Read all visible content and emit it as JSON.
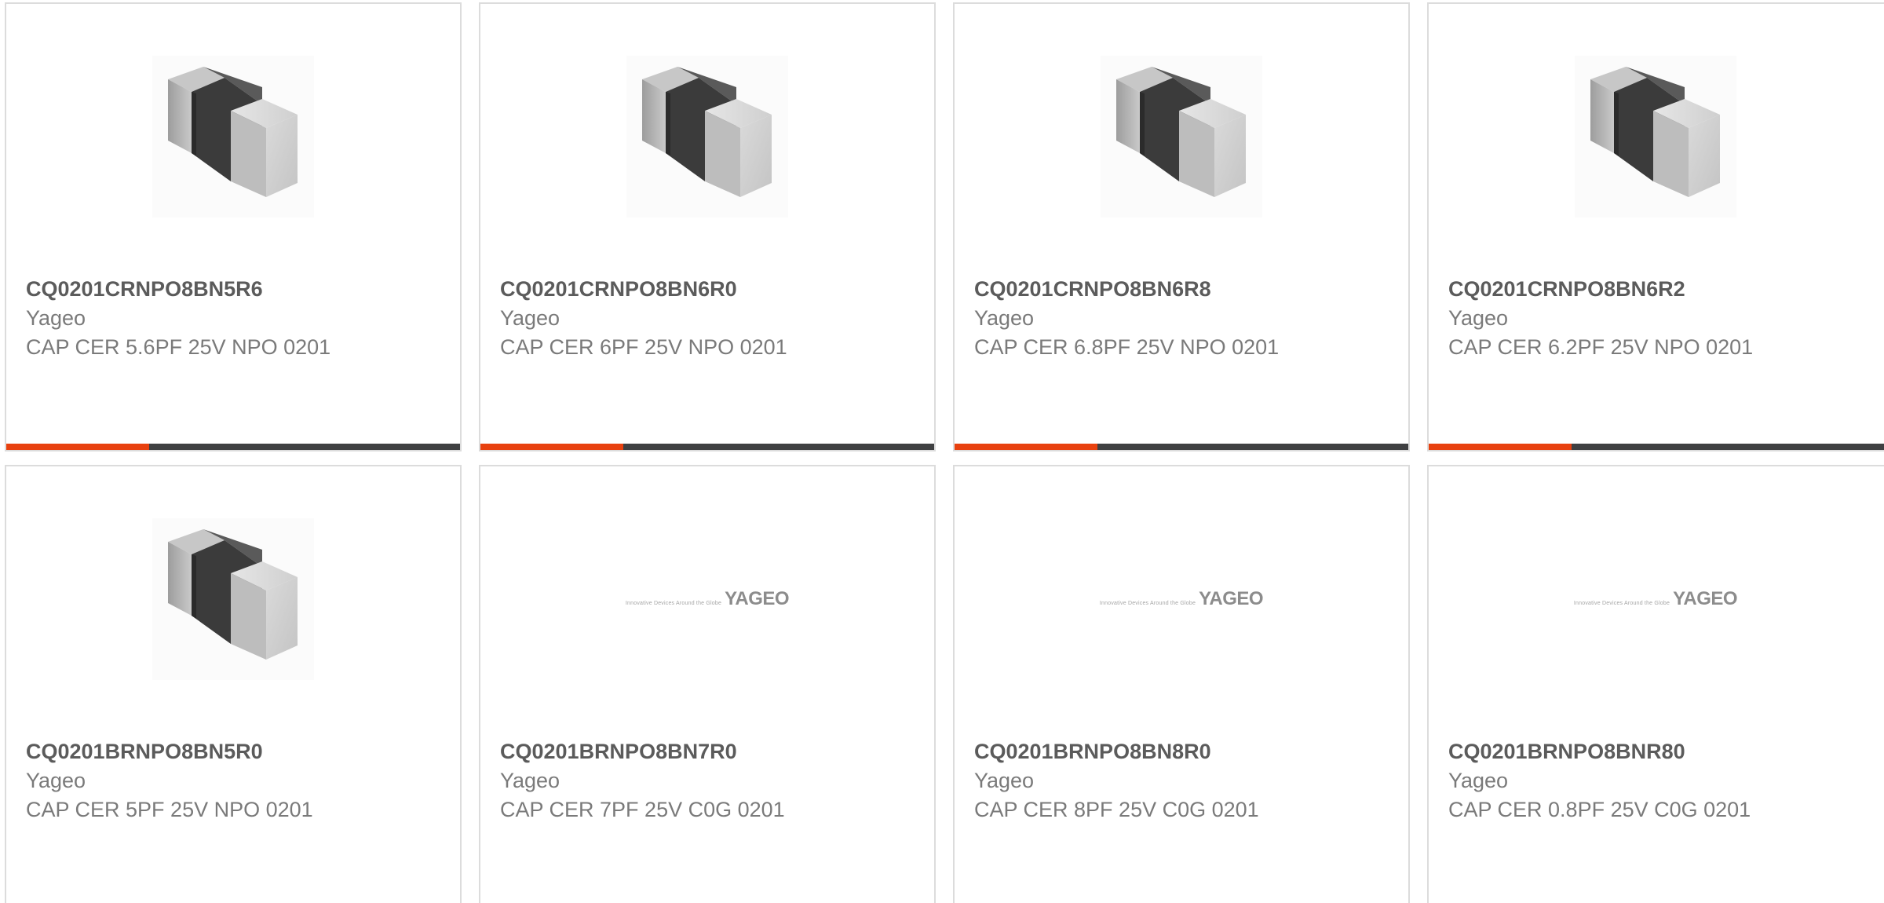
{
  "colors": {
    "accent": "#e8410f",
    "bar": "#3f4042",
    "border": "#dcdcdc"
  },
  "cards": [
    {
      "image": "capacitor-chip-image",
      "part_number": "CQ0201CRNPO8BN5R6",
      "manufacturer": "Yageo",
      "description": "CAP CER 5.6PF 25V NPO 0201",
      "has_bar": true
    },
    {
      "image": "capacitor-chip-image",
      "part_number": "CQ0201CRNPO8BN6R0",
      "manufacturer": "Yageo",
      "description": "CAP CER 6PF 25V NPO 0201",
      "has_bar": true
    },
    {
      "image": "capacitor-chip-image",
      "part_number": "CQ0201CRNPO8BN6R8",
      "manufacturer": "Yageo",
      "description": "CAP CER 6.8PF 25V NPO 0201",
      "has_bar": true
    },
    {
      "image": "capacitor-chip-image",
      "part_number": "CQ0201CRNPO8BN6R2",
      "manufacturer": "Yageo",
      "description": "CAP CER 6.2PF 25V NPO 0201",
      "has_bar": true
    },
    {
      "image": "capacitor-chip-image",
      "part_number": "CQ0201BRNPO8BN5R0",
      "manufacturer": "Yageo",
      "description": "CAP CER 5PF 25V NPO 0201",
      "has_bar": false
    },
    {
      "image": "yageo-logo-image",
      "logo": {
        "tagline": "Innovative Devices Around the Globe",
        "wordmark": "YAGEO"
      },
      "part_number": "CQ0201BRNPO8BN7R0",
      "manufacturer": "Yageo",
      "description": "CAP CER 7PF 25V C0G 0201",
      "has_bar": false
    },
    {
      "image": "yageo-logo-image",
      "logo": {
        "tagline": "Innovative Devices Around the Globe",
        "wordmark": "YAGEO"
      },
      "part_number": "CQ0201BRNPO8BN8R0",
      "manufacturer": "Yageo",
      "description": "CAP CER 8PF 25V C0G 0201",
      "has_bar": false
    },
    {
      "image": "yageo-logo-image",
      "logo": {
        "tagline": "Innovative Devices Around the Globe",
        "wordmark": "YAGEO"
      },
      "part_number": "CQ0201BRNPO8BNR80",
      "manufacturer": "Yageo",
      "description": "CAP CER 0.8PF 25V C0G 0201",
      "has_bar": false
    }
  ]
}
